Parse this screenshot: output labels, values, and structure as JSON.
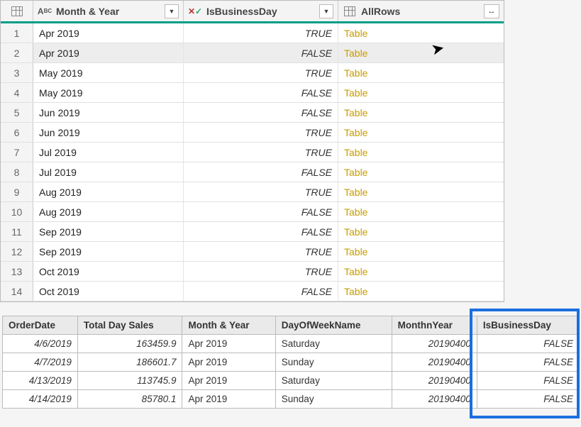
{
  "grid": {
    "headers": {
      "month": "Month & Year",
      "business": "IsBusinessDay",
      "allrows": "AllRows"
    },
    "rows": [
      {
        "n": "1",
        "month": "Apr 2019",
        "bus": "TRUE",
        "all": "Table",
        "sel": false
      },
      {
        "n": "2",
        "month": "Apr 2019",
        "bus": "FALSE",
        "all": "Table",
        "sel": true
      },
      {
        "n": "3",
        "month": "May 2019",
        "bus": "TRUE",
        "all": "Table",
        "sel": false
      },
      {
        "n": "4",
        "month": "May 2019",
        "bus": "FALSE",
        "all": "Table",
        "sel": false
      },
      {
        "n": "5",
        "month": "Jun 2019",
        "bus": "FALSE",
        "all": "Table",
        "sel": false
      },
      {
        "n": "6",
        "month": "Jun 2019",
        "bus": "TRUE",
        "all": "Table",
        "sel": false
      },
      {
        "n": "7",
        "month": "Jul 2019",
        "bus": "TRUE",
        "all": "Table",
        "sel": false
      },
      {
        "n": "8",
        "month": "Jul 2019",
        "bus": "FALSE",
        "all": "Table",
        "sel": false
      },
      {
        "n": "9",
        "month": "Aug 2019",
        "bus": "TRUE",
        "all": "Table",
        "sel": false
      },
      {
        "n": "10",
        "month": "Aug 2019",
        "bus": "FALSE",
        "all": "Table",
        "sel": false
      },
      {
        "n": "11",
        "month": "Sep 2019",
        "bus": "FALSE",
        "all": "Table",
        "sel": false
      },
      {
        "n": "12",
        "month": "Sep 2019",
        "bus": "TRUE",
        "all": "Table",
        "sel": false
      },
      {
        "n": "13",
        "month": "Oct 2019",
        "bus": "TRUE",
        "all": "Table",
        "sel": false
      },
      {
        "n": "14",
        "month": "Oct 2019",
        "bus": "FALSE",
        "all": "Table",
        "sel": false
      }
    ]
  },
  "preview": {
    "headers": [
      "OrderDate",
      "Total Day Sales",
      "Month & Year",
      "DayOfWeekName",
      "MonthnYear",
      "IsBusinessDay"
    ],
    "rows": [
      [
        "4/6/2019",
        "163459.9",
        "Apr 2019",
        "Saturday",
        "20190400",
        "FALSE"
      ],
      [
        "4/7/2019",
        "186601.7",
        "Apr 2019",
        "Sunday",
        "20190400",
        "FALSE"
      ],
      [
        "4/13/2019",
        "113745.9",
        "Apr 2019",
        "Saturday",
        "20190400",
        "FALSE"
      ],
      [
        "4/14/2019",
        "85780.1",
        "Apr 2019",
        "Sunday",
        "20190400",
        "FALSE"
      ]
    ]
  }
}
